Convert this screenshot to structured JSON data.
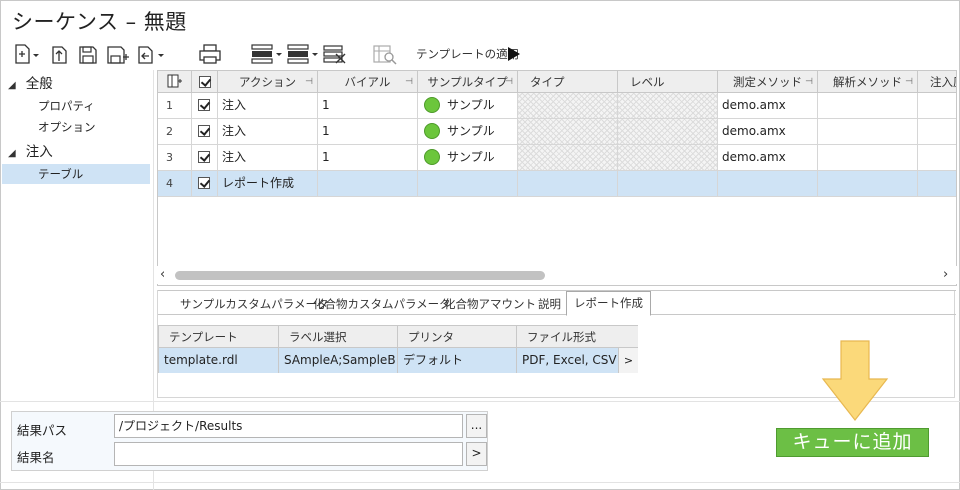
{
  "window": {
    "title": "シーケンス – 無題"
  },
  "toolbar": {
    "template_apply_label": "テンプレートの適用",
    "icons": [
      "new-icon",
      "import-icon",
      "save-icon",
      "save-as-icon",
      "export-icon",
      "print-icon",
      "insert-row-icon",
      "delete-row-icon",
      "clear-rows-icon",
      "template-icon",
      "run-icon"
    ]
  },
  "tree": {
    "groups": [
      {
        "label": "全般",
        "children": [
          "プロパティ",
          "オプション"
        ]
      },
      {
        "label": "注入",
        "children": [
          "テーブル"
        ]
      }
    ],
    "selected": "テーブル"
  },
  "grid": {
    "columns": [
      "アクション",
      "バイアル",
      "サンプルタイプ",
      "タイプ",
      "レベル",
      "測定メソッド",
      "解析メソッド",
      "注入圧"
    ],
    "rows": [
      {
        "index": "1",
        "checked": true,
        "action": "注入",
        "vial": "1",
        "sample_type": "サンプル",
        "method": "demo.amx"
      },
      {
        "index": "2",
        "checked": true,
        "action": "注入",
        "vial": "1",
        "sample_type": "サンプル",
        "method": "demo.amx"
      },
      {
        "index": "3",
        "checked": true,
        "action": "注入",
        "vial": "1",
        "sample_type": "サンプル",
        "method": "demo.amx"
      },
      {
        "index": "4",
        "checked": true,
        "action": "レポート作成",
        "vial": "",
        "sample_type": "",
        "method": ""
      }
    ],
    "sample_color": "#6cc63c",
    "selected_row_color": "#cfe3f5"
  },
  "tabs": {
    "items": [
      "サンプルカスタムパラメータ",
      "化合物カスタムパラメータ",
      "化合物アマウント",
      "説明",
      "レポート作成"
    ],
    "active": "レポート作成"
  },
  "report_table": {
    "headers": [
      "テンプレート",
      "ラベル選択",
      "プリンタ",
      "ファイル形式"
    ],
    "row": [
      "template.rdl",
      "SAmpleA;SampleB",
      "デフォルト",
      "PDF, Excel, CSV"
    ],
    "more_button": ">"
  },
  "results": {
    "path_label": "結果パス",
    "path_value": "/プロジェクト/Results",
    "path_button": "...",
    "name_label": "結果名",
    "name_value": "",
    "name_button": ">"
  },
  "queue_button": {
    "label": "キューに追加",
    "color": "#6cbf45"
  },
  "arrow_color": "#fbd97a"
}
